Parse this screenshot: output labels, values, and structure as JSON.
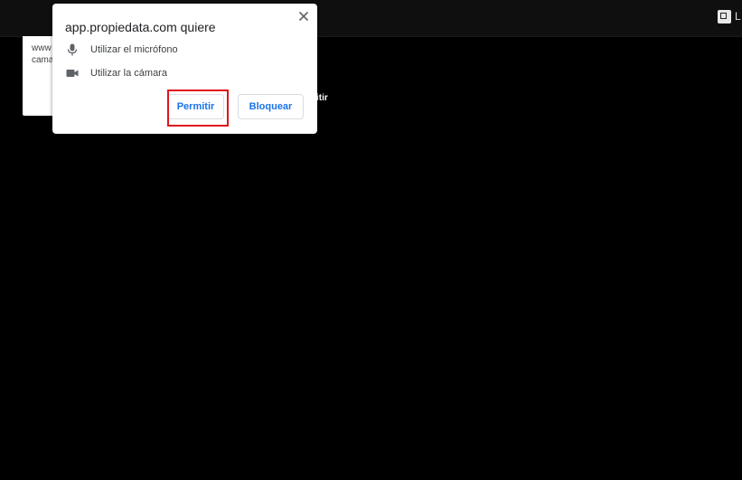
{
  "colors": {
    "accent": "#1a73e8",
    "highlight": "#e0141e",
    "background": "#000000"
  },
  "top_bar": {
    "right_icon": "window-restore-icon",
    "right_text": "L"
  },
  "behind_notice": {
    "line1": "www",
    "line2": "cama"
  },
  "behind_text": "itir",
  "popup": {
    "title": "app.propiedata.com quiere",
    "close_icon": "close-icon",
    "permissions": [
      {
        "icon": "microphone-icon",
        "label": "Utilizar el micrófono"
      },
      {
        "icon": "camera-icon",
        "label": "Utilizar la cámara"
      }
    ],
    "allow_label": "Permitir",
    "block_label": "Bloquear"
  }
}
